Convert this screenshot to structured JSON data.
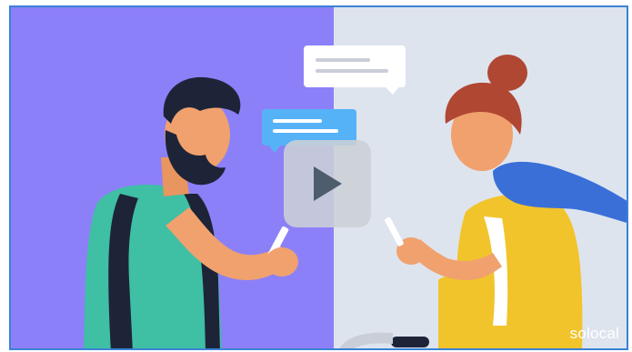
{
  "video": {
    "brand_logo_text": "solocal",
    "play_icon": "play-icon",
    "colors": {
      "left_background": "#8c80f8",
      "right_background": "#dde4ee",
      "border": "#3b82d6",
      "chat_bubble_blue": "#55b2f7",
      "chat_bubble_white": "#ffffff"
    }
  }
}
